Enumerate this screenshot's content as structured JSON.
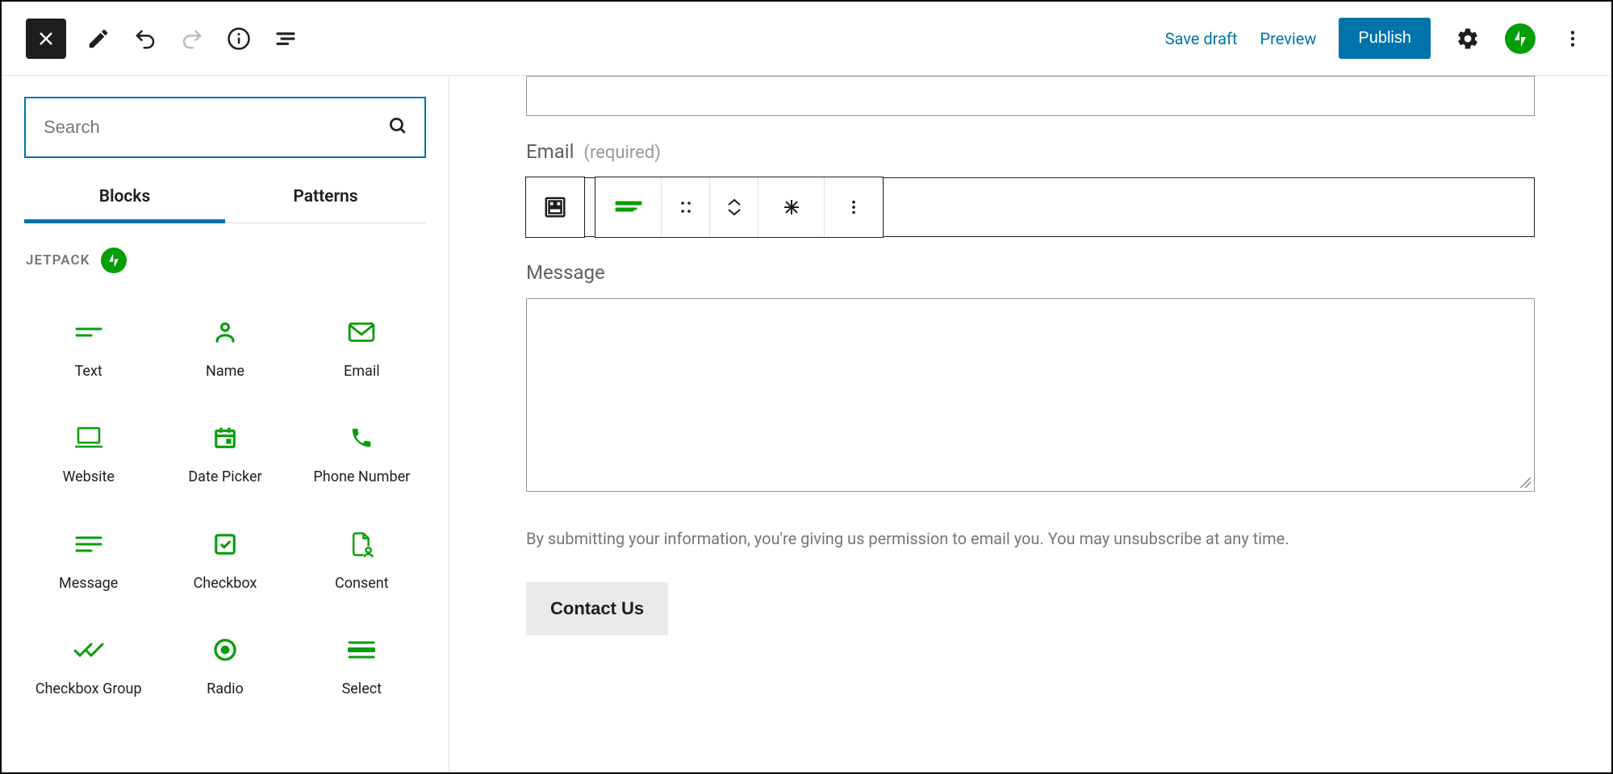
{
  "toolbar": {
    "save_draft": "Save draft",
    "preview": "Preview",
    "publish": "Publish"
  },
  "sidebar": {
    "search_placeholder": "Search",
    "tabs": {
      "blocks": "Blocks",
      "patterns": "Patterns"
    },
    "section": "JETPACK",
    "blocks": [
      {
        "label": "Text",
        "icon": "text"
      },
      {
        "label": "Name",
        "icon": "person"
      },
      {
        "label": "Email",
        "icon": "mail"
      },
      {
        "label": "Website",
        "icon": "laptop"
      },
      {
        "label": "Date Picker",
        "icon": "calendar"
      },
      {
        "label": "Phone Number",
        "icon": "phone"
      },
      {
        "label": "Message",
        "icon": "subject"
      },
      {
        "label": "Checkbox",
        "icon": "checkbox"
      },
      {
        "label": "Consent",
        "icon": "document"
      },
      {
        "label": "Checkbox Group",
        "icon": "checkgroup"
      },
      {
        "label": "Radio",
        "icon": "radio"
      },
      {
        "label": "Select",
        "icon": "select"
      }
    ]
  },
  "form": {
    "email_label": "Email",
    "email_req": "(required)",
    "message_label": "Message",
    "disclaimer": "By submitting your information, you're giving us permission to email you. You may unsubscribe at any time.",
    "submit": "Contact Us"
  }
}
